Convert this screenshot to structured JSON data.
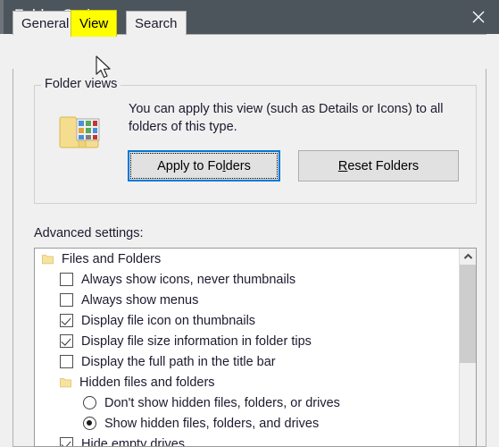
{
  "window": {
    "title": "Folder Options",
    "close_icon": "close-icon"
  },
  "tabs": [
    {
      "label": "General",
      "selected": false
    },
    {
      "label": "View",
      "selected": true,
      "highlight_color": "#ffff00"
    },
    {
      "label": "Search",
      "selected": false
    }
  ],
  "folder_views": {
    "group_title": "Folder views",
    "icon": "folder-with-thumbnails-icon",
    "description": "You can apply this view (such as Details or Icons) to all folders of this type.",
    "apply_button": {
      "label_before": "Apply to Fo",
      "accel": "l",
      "label_after": "ders",
      "focused": true
    },
    "reset_button": {
      "accel": "R",
      "label_after": "eset Folders"
    }
  },
  "advanced": {
    "label": "Advanced settings:",
    "items": [
      {
        "type": "group",
        "label": "Files and Folders",
        "icon": "folder-icon"
      },
      {
        "type": "check",
        "label": "Always show icons, never thumbnails",
        "checked": false
      },
      {
        "type": "check",
        "label": "Always show menus",
        "checked": false
      },
      {
        "type": "check",
        "label": "Display file icon on thumbnails",
        "checked": true
      },
      {
        "type": "check",
        "label": "Display file size information in folder tips",
        "checked": true
      },
      {
        "type": "check",
        "label": "Display the full path in the title bar",
        "checked": false
      },
      {
        "type": "group",
        "label": "Hidden files and folders",
        "icon": "folder-icon",
        "indent": true
      },
      {
        "type": "radio",
        "label": "Don't show hidden files, folders, or drives",
        "selected": false
      },
      {
        "type": "radio",
        "label": "Show hidden files, folders, and drives",
        "selected": true
      },
      {
        "type": "check",
        "label": "Hide empty drives",
        "checked": true
      }
    ],
    "scrollbar": {
      "up_arrow_icon": "chevron-up-icon"
    }
  },
  "colors": {
    "titlebar": "#4c555c",
    "accent": "#0078d7",
    "highlight": "#ffff00",
    "dialog_bg": "#f0f0f0"
  }
}
